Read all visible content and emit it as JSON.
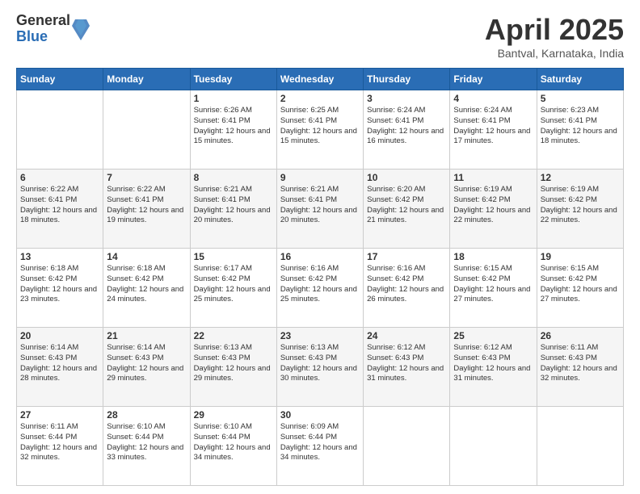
{
  "logo": {
    "general": "General",
    "blue": "Blue"
  },
  "header": {
    "title": "April 2025",
    "location": "Bantval, Karnataka, India"
  },
  "weekdays": [
    "Sunday",
    "Monday",
    "Tuesday",
    "Wednesday",
    "Thursday",
    "Friday",
    "Saturday"
  ],
  "weeks": [
    [
      {
        "day": "",
        "info": ""
      },
      {
        "day": "",
        "info": ""
      },
      {
        "day": "1",
        "info": "Sunrise: 6:26 AM\nSunset: 6:41 PM\nDaylight: 12 hours and 15 minutes."
      },
      {
        "day": "2",
        "info": "Sunrise: 6:25 AM\nSunset: 6:41 PM\nDaylight: 12 hours and 15 minutes."
      },
      {
        "day": "3",
        "info": "Sunrise: 6:24 AM\nSunset: 6:41 PM\nDaylight: 12 hours and 16 minutes."
      },
      {
        "day": "4",
        "info": "Sunrise: 6:24 AM\nSunset: 6:41 PM\nDaylight: 12 hours and 17 minutes."
      },
      {
        "day": "5",
        "info": "Sunrise: 6:23 AM\nSunset: 6:41 PM\nDaylight: 12 hours and 18 minutes."
      }
    ],
    [
      {
        "day": "6",
        "info": "Sunrise: 6:22 AM\nSunset: 6:41 PM\nDaylight: 12 hours and 18 minutes."
      },
      {
        "day": "7",
        "info": "Sunrise: 6:22 AM\nSunset: 6:41 PM\nDaylight: 12 hours and 19 minutes."
      },
      {
        "day": "8",
        "info": "Sunrise: 6:21 AM\nSunset: 6:41 PM\nDaylight: 12 hours and 20 minutes."
      },
      {
        "day": "9",
        "info": "Sunrise: 6:21 AM\nSunset: 6:41 PM\nDaylight: 12 hours and 20 minutes."
      },
      {
        "day": "10",
        "info": "Sunrise: 6:20 AM\nSunset: 6:42 PM\nDaylight: 12 hours and 21 minutes."
      },
      {
        "day": "11",
        "info": "Sunrise: 6:19 AM\nSunset: 6:42 PM\nDaylight: 12 hours and 22 minutes."
      },
      {
        "day": "12",
        "info": "Sunrise: 6:19 AM\nSunset: 6:42 PM\nDaylight: 12 hours and 22 minutes."
      }
    ],
    [
      {
        "day": "13",
        "info": "Sunrise: 6:18 AM\nSunset: 6:42 PM\nDaylight: 12 hours and 23 minutes."
      },
      {
        "day": "14",
        "info": "Sunrise: 6:18 AM\nSunset: 6:42 PM\nDaylight: 12 hours and 24 minutes."
      },
      {
        "day": "15",
        "info": "Sunrise: 6:17 AM\nSunset: 6:42 PM\nDaylight: 12 hours and 25 minutes."
      },
      {
        "day": "16",
        "info": "Sunrise: 6:16 AM\nSunset: 6:42 PM\nDaylight: 12 hours and 25 minutes."
      },
      {
        "day": "17",
        "info": "Sunrise: 6:16 AM\nSunset: 6:42 PM\nDaylight: 12 hours and 26 minutes."
      },
      {
        "day": "18",
        "info": "Sunrise: 6:15 AM\nSunset: 6:42 PM\nDaylight: 12 hours and 27 minutes."
      },
      {
        "day": "19",
        "info": "Sunrise: 6:15 AM\nSunset: 6:42 PM\nDaylight: 12 hours and 27 minutes."
      }
    ],
    [
      {
        "day": "20",
        "info": "Sunrise: 6:14 AM\nSunset: 6:43 PM\nDaylight: 12 hours and 28 minutes."
      },
      {
        "day": "21",
        "info": "Sunrise: 6:14 AM\nSunset: 6:43 PM\nDaylight: 12 hours and 29 minutes."
      },
      {
        "day": "22",
        "info": "Sunrise: 6:13 AM\nSunset: 6:43 PM\nDaylight: 12 hours and 29 minutes."
      },
      {
        "day": "23",
        "info": "Sunrise: 6:13 AM\nSunset: 6:43 PM\nDaylight: 12 hours and 30 minutes."
      },
      {
        "day": "24",
        "info": "Sunrise: 6:12 AM\nSunset: 6:43 PM\nDaylight: 12 hours and 31 minutes."
      },
      {
        "day": "25",
        "info": "Sunrise: 6:12 AM\nSunset: 6:43 PM\nDaylight: 12 hours and 31 minutes."
      },
      {
        "day": "26",
        "info": "Sunrise: 6:11 AM\nSunset: 6:43 PM\nDaylight: 12 hours and 32 minutes."
      }
    ],
    [
      {
        "day": "27",
        "info": "Sunrise: 6:11 AM\nSunset: 6:44 PM\nDaylight: 12 hours and 32 minutes."
      },
      {
        "day": "28",
        "info": "Sunrise: 6:10 AM\nSunset: 6:44 PM\nDaylight: 12 hours and 33 minutes."
      },
      {
        "day": "29",
        "info": "Sunrise: 6:10 AM\nSunset: 6:44 PM\nDaylight: 12 hours and 34 minutes."
      },
      {
        "day": "30",
        "info": "Sunrise: 6:09 AM\nSunset: 6:44 PM\nDaylight: 12 hours and 34 minutes."
      },
      {
        "day": "",
        "info": ""
      },
      {
        "day": "",
        "info": ""
      },
      {
        "day": "",
        "info": ""
      }
    ]
  ]
}
